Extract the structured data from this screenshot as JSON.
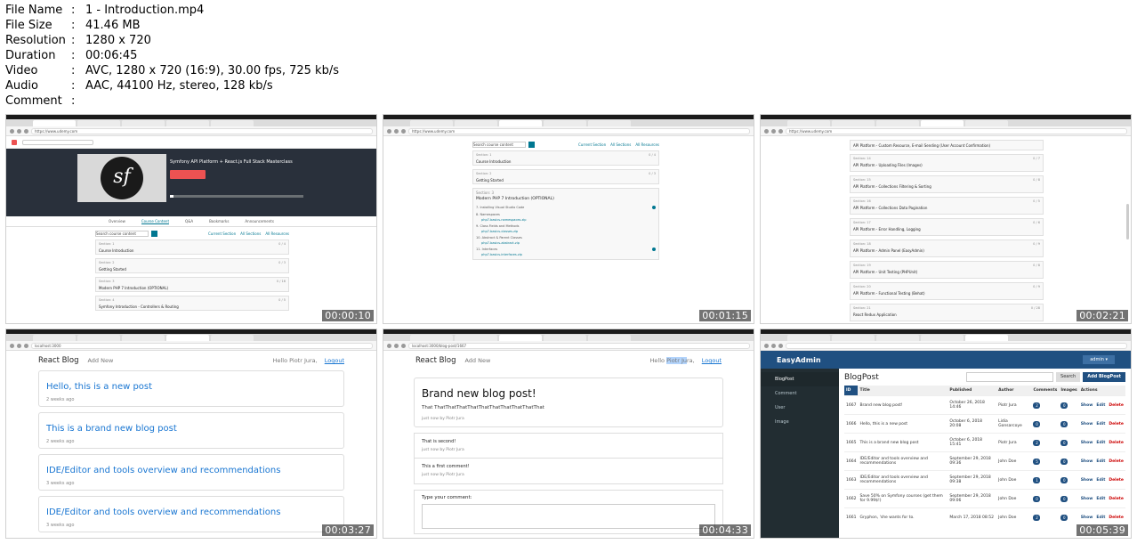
{
  "meta": [
    {
      "key": "File Name",
      "value": "1 - Introduction.mp4"
    },
    {
      "key": "File Size",
      "value": "41.46 MB"
    },
    {
      "key": "Resolution",
      "value": "1280 x 720"
    },
    {
      "key": "Duration",
      "value": "00:06:45"
    },
    {
      "key": "Video",
      "value": "AVC, 1280 x 720 (16:9), 30.00 fps, 725 kb/s"
    },
    {
      "key": "Audio",
      "value": "AAC, 44100 Hz, stereo, 128 kb/s"
    },
    {
      "key": "Comment",
      "value": ""
    }
  ],
  "thumbs": {
    "t1": {
      "timestamp": "00:00:10",
      "url": "https://www.udemy.com",
      "hero_title": "Symfony API Platform + React.js Full Stack Masterclass",
      "tabs": [
        "Overview",
        "Course Content",
        "Q&A",
        "Bookmarks",
        "Announcements"
      ],
      "search_placeholder": "Search course content",
      "links": [
        "Current Section",
        "All Sections",
        "All Resources"
      ],
      "sections": [
        {
          "label": "Section: 1",
          "title": "Course Introduction",
          "count": "0 / 4"
        },
        {
          "label": "Section: 2",
          "title": "Getting Started",
          "count": "0 / 3"
        },
        {
          "label": "Section: 3",
          "title": "Modern PHP 7 Introduction (OPTIONAL)",
          "count": "0 / 16"
        },
        {
          "label": "Section: 4",
          "title": "Symfony Introduction - Controllers & Routing",
          "count": "0 / 5"
        }
      ]
    },
    "t2": {
      "timestamp": "00:01:15",
      "url": "https://www.udemy.com",
      "search_placeholder": "Search course content",
      "links": [
        "Current Section",
        "All Sections",
        "All Resources"
      ],
      "sections": [
        {
          "label": "Section: 1",
          "title": "Course Introduction",
          "count": "0 / 4"
        },
        {
          "label": "Section: 2",
          "title": "Getting Started",
          "count": "0 / 3"
        },
        {
          "label": "Section: 3",
          "title": "Modern PHP 7 Introduction (OPTIONAL)",
          "count": "0 / 16"
        }
      ],
      "lectures": [
        "7. Installing Visual Studio Code",
        "8. Namespaces",
        "9. Class Fields and Methods",
        "10. Abstract & Parent Classes",
        "11. Interfaces"
      ],
      "resources": [
        "php7-basics-namespaces.zip",
        "php7-basics-classes.zip",
        "php7-basics-abstract.zip",
        "php7-basics-interfaces.zip"
      ]
    },
    "t3": {
      "timestamp": "00:02:21",
      "url": "https://www.udemy.com",
      "sections": [
        {
          "label": "",
          "title": "API Platform - Custom Resource, E-mail Sending (User Account Confirmation)",
          "count": ""
        },
        {
          "label": "Section: 14",
          "title": "API Platform - Uploading Files (Images)",
          "count": "0 / 7"
        },
        {
          "label": "Section: 15",
          "title": "API Platform - Collections Filtering & Sorting",
          "count": "0 / 8"
        },
        {
          "label": "Section: 16",
          "title": "API Platform - Collections Data Pagination",
          "count": "0 / 5"
        },
        {
          "label": "Section: 17",
          "title": "API Platform - Error Handling, Logging",
          "count": "0 / 6"
        },
        {
          "label": "Section: 18",
          "title": "API Platform - Admin Panel (EasyAdmin)",
          "count": "0 / 9"
        },
        {
          "label": "Section: 19",
          "title": "API Platform - Unit Testing (PHPUnit)",
          "count": "0 / 8"
        },
        {
          "label": "Section: 20",
          "title": "API Platform - Functional Testing (Behat)",
          "count": "0 / 9"
        },
        {
          "label": "Section: 21",
          "title": "React Redux Application",
          "count": "0 / 28"
        }
      ]
    },
    "t4": {
      "timestamp": "00:03:27",
      "url": "localhost:3000",
      "brand": "React Blog",
      "add_new": "Add New",
      "user": "Hello Piotr Jura,",
      "logout": "Logout",
      "posts": [
        {
          "title": "Hello, this is a new post",
          "meta": "2 weeks ago"
        },
        {
          "title": "This is a brand new blog post",
          "meta": "2 weeks ago"
        },
        {
          "title": "IDE/Editor and tools overview and recommendations",
          "meta": "3 weeks ago"
        },
        {
          "title": "IDE/Editor and tools overview and recommendations",
          "meta": "3 weeks ago"
        }
      ]
    },
    "t5": {
      "timestamp": "00:04:33",
      "url": "localhost:3000/blog-post/1667",
      "brand": "React Blog",
      "add_new": "Add New",
      "user_pre": "Hello",
      "user_hl": "Piotr Ju",
      "user_post": "ra,",
      "logout": "Logout",
      "post_title": "Brand new blog post!",
      "post_body": "That ThatThatThatThatThatThatThatThatThatThat",
      "post_meta": "just now by Piotr Jura",
      "comments": [
        {
          "text": "That is second!",
          "meta": "just now by Piotr Jura"
        },
        {
          "text": "This a first comment!",
          "meta": "just now by Piotr Jura"
        }
      ],
      "form_label": "Type your comment:"
    },
    "t6": {
      "timestamp": "00:05:39",
      "brand": "EasyAdmin",
      "admin": "admin ▾",
      "menu": [
        "BlogPost",
        "Comment",
        "User",
        "Image"
      ],
      "title": "BlogPost",
      "search_btn": "Search",
      "add_btn": "Add BlogPost",
      "columns": [
        "ID",
        "Title",
        "Published",
        "Author",
        "Comments",
        "Images",
        "Actions"
      ],
      "rows": [
        {
          "id": "1667",
          "title": "Brand new blog post!",
          "published": "October 26, 2018 14:46",
          "author": "Piotr Jura",
          "comments": "2",
          "images": "0"
        },
        {
          "id": "1666",
          "title": "Hello, this is a new post",
          "published": "October 6, 2018 20:08",
          "author": "Lidia Gonsarcoye",
          "comments": "0",
          "images": "0"
        },
        {
          "id": "1665",
          "title": "This is a brand new blog post",
          "published": "October 6, 2018 15:41",
          "author": "Piotr Jura",
          "comments": "2",
          "images": "0"
        },
        {
          "id": "1664",
          "title": "IDE/Editor and tools overview and recommendations",
          "published": "September 29, 2018 09:36",
          "author": "John Doe",
          "comments": "5",
          "images": "0"
        },
        {
          "id": "1663",
          "title": "IDE/Editor and tools overview and recommendations",
          "published": "September 29, 2018 09:38",
          "author": "John Doe",
          "comments": "1",
          "images": "0"
        },
        {
          "id": "1662",
          "title": "Save 50% on Symfony courses (get them for 9.99$!)",
          "published": "September 29, 2018 09:06",
          "author": "John Doe",
          "comments": "0",
          "images": "0"
        },
        {
          "id": "1661",
          "title": "Gryphon, 'she wants for to.",
          "published": "March 17, 2018 08:52",
          "author": "John Doe",
          "comments": "2",
          "images": "0"
        }
      ],
      "actions": {
        "show": "Show",
        "edit": "Edit",
        "delete": "Delete"
      }
    }
  }
}
